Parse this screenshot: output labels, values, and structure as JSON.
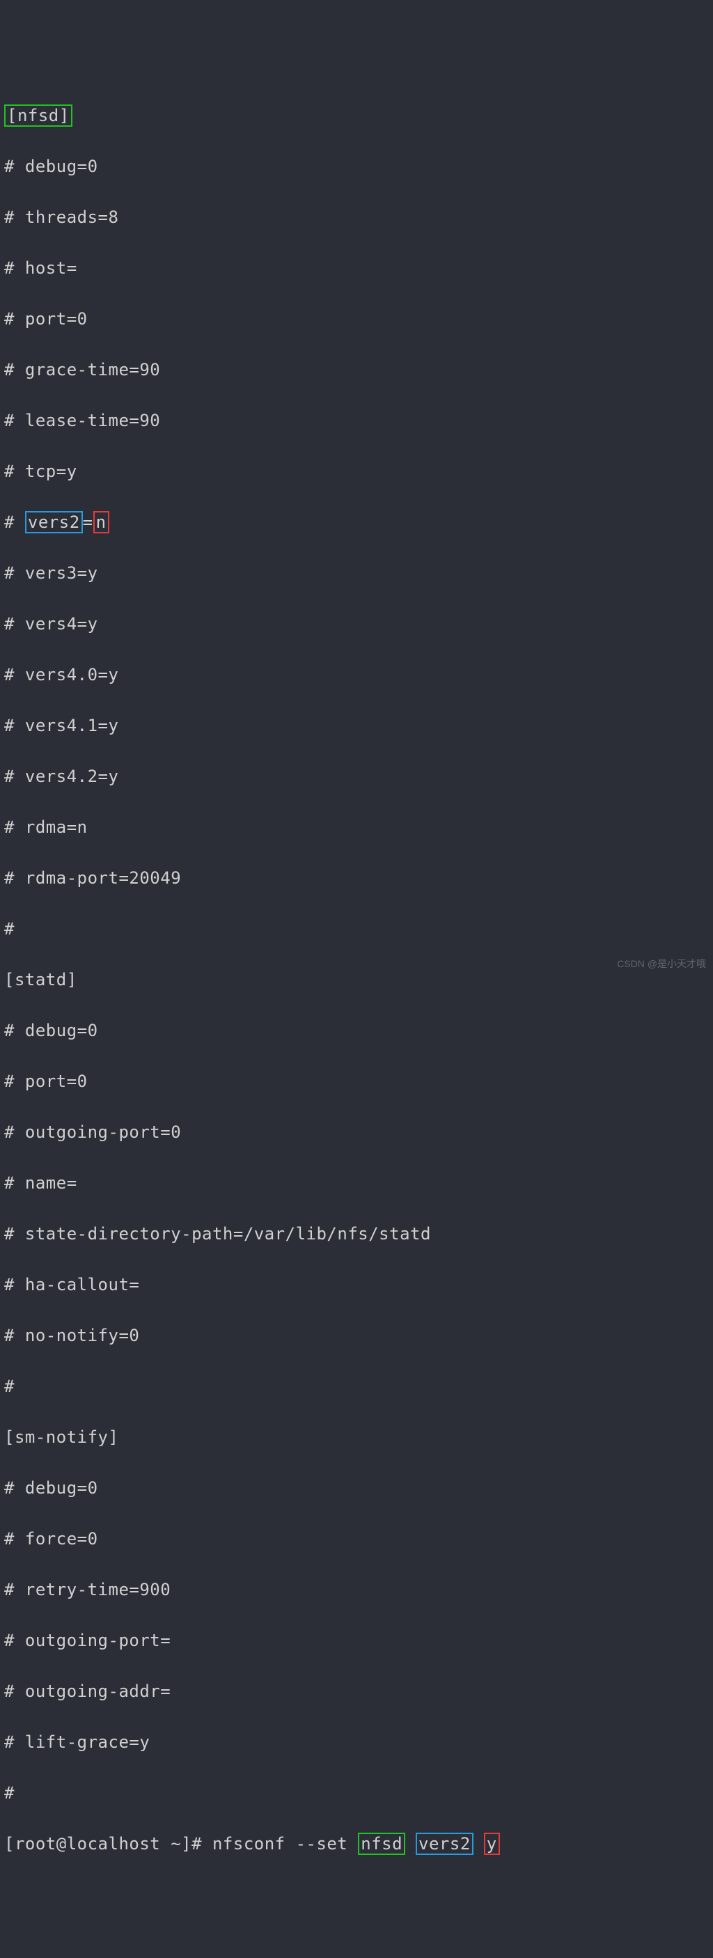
{
  "lines": {
    "l0_box": "[nfsd]",
    "l1": "# debug=0",
    "l2": "# threads=8",
    "l3": "# host=",
    "l4": "# port=0",
    "l5": "# grace-time=90",
    "l6": "# lease-time=90",
    "l7": "# tcp=y",
    "l8_prefix": "# ",
    "l8_box_blue": "vers2",
    "l8_mid": "=",
    "l8_box_red": "n",
    "l9": "# vers3=y",
    "l10": "# vers4=y",
    "l11": "# vers4.0=y",
    "l12": "# vers4.1=y",
    "l13": "# vers4.2=y",
    "l14": "# rdma=n",
    "l15": "# rdma-port=20049",
    "l16": "#",
    "l17": "[statd]",
    "l18": "# debug=0",
    "l19": "# port=0",
    "l20": "# outgoing-port=0",
    "l21": "# name=",
    "l22": "# state-directory-path=/var/lib/nfs/statd",
    "l23": "# ha-callout=",
    "l24": "# no-notify=0",
    "l25": "#",
    "l26": "[sm-notify]",
    "l27": "# debug=0",
    "l28": "# force=0",
    "l29": "# retry-time=900",
    "l30": "# outgoing-port=",
    "l31": "# outgoing-addr=",
    "l32": "# lift-grace=y",
    "l33": "#",
    "l34_prompt": "[root@localhost ~]# ",
    "l34_cmd1": "nfsconf --set ",
    "l34_box_green": "nfsd",
    "l34_sp1": " ",
    "l34_box_blue": "vers2",
    "l34_sp2": " ",
    "l34_box_red": "y"
  },
  "watermark": "CSDN @是小天才哦"
}
